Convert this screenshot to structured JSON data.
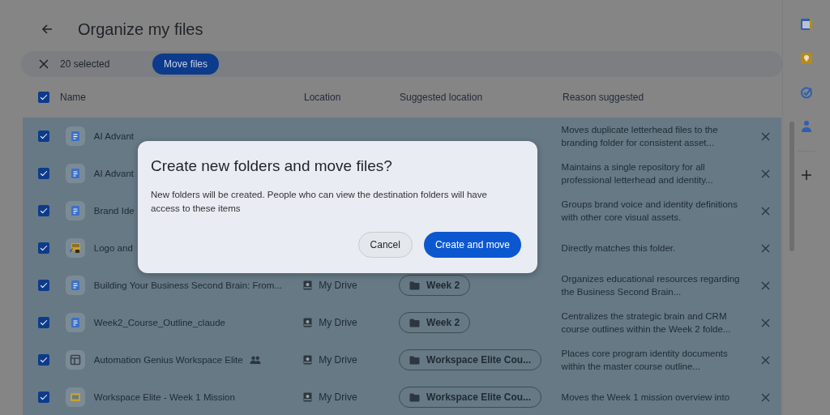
{
  "header": {
    "title": "Organize my files"
  },
  "selection_bar": {
    "count": "20 selected",
    "action": "Move files"
  },
  "table": {
    "select_all": {
      "checked": true
    },
    "columns": [
      "Name",
      "Location",
      "Suggested location",
      "Reason suggested"
    ],
    "rows": [
      {
        "kind": "doc",
        "checked": true,
        "name": "AI Advant",
        "shared": false,
        "reason": "Moves duplicate letterhead files to the branding folder for consistent asset..."
      },
      {
        "kind": "doc",
        "checked": true,
        "name": "AI Advant",
        "shared": false,
        "reason": "Maintains a single repository for all professional letterhead and identity..."
      },
      {
        "kind": "doc",
        "checked": true,
        "name": "Brand Ide",
        "shared": false,
        "reason": "Groups brand voice and identity definitions with other core visual assets."
      },
      {
        "kind": "image",
        "checked": true,
        "name": "Logo and",
        "shared": false,
        "reason": "Directly matches this folder."
      },
      {
        "kind": "doc",
        "checked": true,
        "name": "Building Your Business Second Brain: From...",
        "shared": false,
        "location": "My Drive",
        "suggested": "Week 2",
        "reason": "Organizes educational resources regarding the Business Second Brain..."
      },
      {
        "kind": "doc",
        "checked": true,
        "name": "Week2_Course_Outline_claude",
        "shared": false,
        "location": "My Drive",
        "suggested": "Week 2",
        "reason": "Centralizes the strategic brain and CRM course outlines within the Week 2 folde..."
      },
      {
        "kind": "site",
        "checked": true,
        "name": "Automation Genius Workspace Elite",
        "shared": true,
        "location": "My Drive",
        "suggested": "Workspace Elite Cou...",
        "reason": "Places core program identity documents within the master course outline..."
      },
      {
        "kind": "slides",
        "checked": true,
        "name": "Workspace Elite - Week 1 Mission",
        "shared": false,
        "location": "My Drive",
        "suggested": "Workspace Elite Cou...",
        "reason": "Moves the Week 1 mission overview into"
      }
    ]
  },
  "dialog": {
    "title": "Create new folders and move files?",
    "body": "New folders will be created. People who can view the destination folders will have access to these items",
    "buttons": [
      {
        "kind": "secondary",
        "label": "Cancel"
      },
      {
        "kind": "primary",
        "label": "Create and move"
      }
    ]
  }
}
